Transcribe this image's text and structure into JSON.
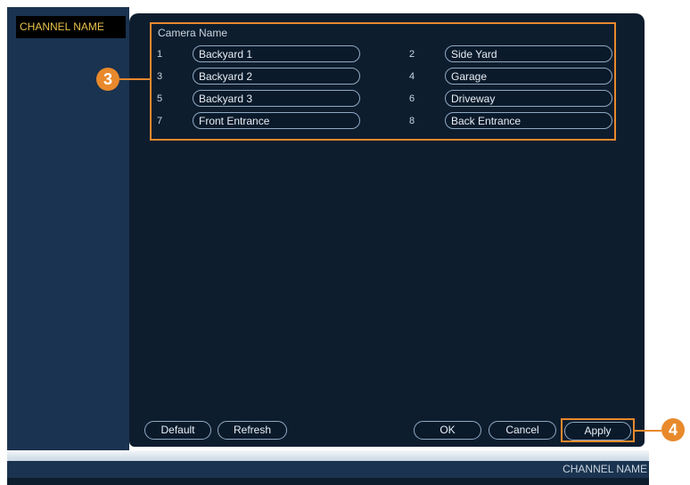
{
  "sidebar": {
    "active_item": "CHANNEL NAME"
  },
  "camera_group": {
    "title": "Camera Name",
    "channels": [
      {
        "number": "1",
        "name": "Backyard 1"
      },
      {
        "number": "2",
        "name": "Side Yard"
      },
      {
        "number": "3",
        "name": "Backyard 2"
      },
      {
        "number": "4",
        "name": "Garage"
      },
      {
        "number": "5",
        "name": "Backyard 3"
      },
      {
        "number": "6",
        "name": "Driveway"
      },
      {
        "number": "7",
        "name": "Front Entrance"
      },
      {
        "number": "8",
        "name": "Back Entrance"
      }
    ]
  },
  "callouts": {
    "camera_names": "3",
    "apply": "4"
  },
  "buttons": {
    "default": "Default",
    "refresh": "Refresh",
    "ok": "OK",
    "cancel": "Cancel",
    "apply": "Apply"
  },
  "status_bar": {
    "label": "CHANNEL NAME"
  },
  "colors": {
    "accent": "#e8892c",
    "panel": "#0e1d2e",
    "sidebar": "#1a3350",
    "tab_text": "#e8c24b"
  }
}
